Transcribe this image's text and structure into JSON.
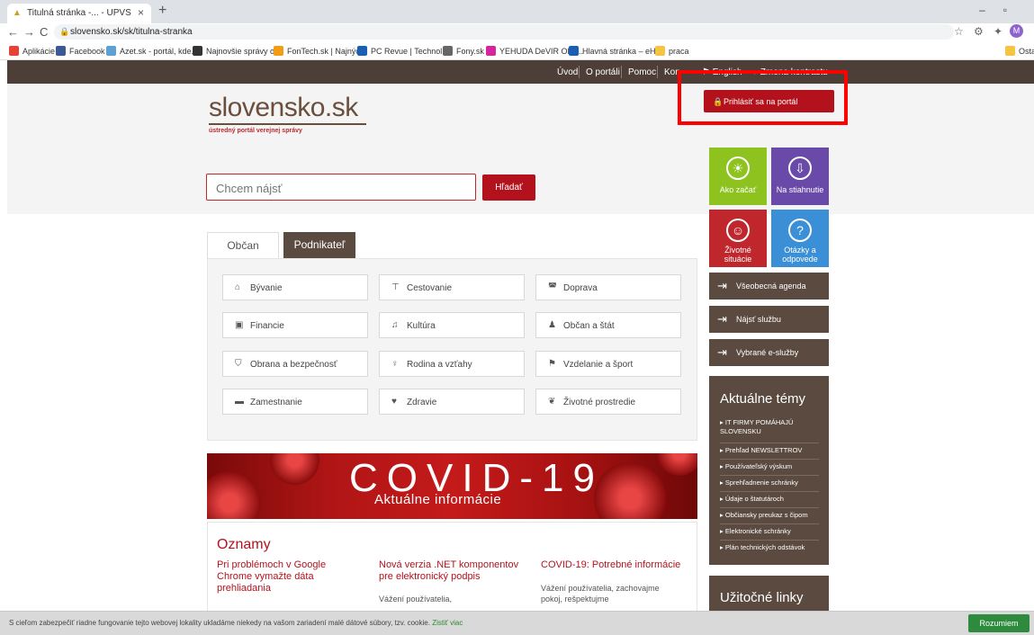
{
  "browser": {
    "tab_title": "Titulná stránka -... - UPVS",
    "tab_close": "×",
    "new_tab": "+",
    "url": "slovensko.sk/sk/titulna-stranka",
    "avatar_letter": "M",
    "bookmarks": [
      {
        "label": "Aplikácie",
        "color": "#e94235"
      },
      {
        "label": "Facebook",
        "color": "#3b5998"
      },
      {
        "label": "Azet.sk - portál, kde...",
        "color": "#5ba1d6"
      },
      {
        "label": "Najnovšie správy o...",
        "color": "#333333"
      },
      {
        "label": "FonTech.sk | Najnýc...",
        "color": "#f39c12"
      },
      {
        "label": "PC Revue | Technol...",
        "color": "#1a5fb4"
      },
      {
        "label": "Fony.sk",
        "color": "#666666"
      },
      {
        "label": "YEHUDA DeVIR OFF...",
        "color": "#d6249f"
      },
      {
        "label": "Hlavná stránka – eH...",
        "color": "#1a5fb4"
      },
      {
        "label": "praca",
        "color": "#f5c542"
      },
      {
        "label": "Ostat",
        "color": "#f5c542"
      }
    ]
  },
  "site_nav": {
    "items": [
      "Úvod",
      "O portáli",
      "Pomoc",
      "Kon"
    ],
    "english": "English",
    "contrast": "Zmena kontrastu"
  },
  "header": {
    "logo": "slovensko.sk",
    "logo_sub": "ústredný portál verejnej správy",
    "login": "Prihlásiť sa na portál"
  },
  "search": {
    "placeholder": "Chcem nájsť",
    "button": "Hľadať"
  },
  "tiles": {
    "ako_zacat": "Ako začať",
    "na_stiahnutie": "Na stiahnutie",
    "zivotne_situacie": "Životné situácie",
    "otazky": "Otázky a odpovede"
  },
  "side_buttons": [
    "Všeobecná agenda",
    "Nájsť službu",
    "Vybrané e-služby"
  ],
  "tabs": {
    "obcan": "Občan",
    "podnikatel": "Podnikateľ"
  },
  "categories": [
    "Bývanie",
    "Cestovanie",
    "Doprava",
    "Financie",
    "Kultúra",
    "Občan a štát",
    "Obrana a bezpečnosť",
    "Rodina a vzťahy",
    "Vzdelanie a šport",
    "Zamestnanie",
    "Zdravie",
    "Životné prostredie"
  ],
  "covid": {
    "title": "COVID-19",
    "subtitle": "Aktuálne informácie"
  },
  "news": {
    "heading": "Oznamy",
    "items": [
      {
        "title": "Pri problémoch v Google Chrome vymažte dáta prehliadania",
        "text": ""
      },
      {
        "title": "Nová verzia .NET komponentov pre elektronický podpis",
        "text": "Vážení používatelia,"
      },
      {
        "title": "COVID-19: Potrebné informácie",
        "text": "Vážení používatelia, zachovajme pokoj, rešpektujme"
      }
    ]
  },
  "aktualne": {
    "heading": "Aktuálne témy",
    "items": [
      "IT FIRMY POMÁHAJÚ SLOVENSKU",
      "Prehľad NEWSLETTROV",
      "Používateľský výskum",
      "Sprehľadnenie schránky",
      "Údaje o štatutároch",
      "Občiansky preukaz s čipom",
      "Elektronické schránky",
      "Plán technických odstávok"
    ]
  },
  "uzitocne": {
    "heading": "Užitočné linky"
  },
  "cookie": {
    "text": "S cieľom zabezpečiť riadne fungovanie tejto webovej lokality ukladáme niekedy na vašom zariadení malé dátové súbory, tzv. cookie.",
    "link": "Zistiť viac",
    "button": "Rozumiem"
  }
}
